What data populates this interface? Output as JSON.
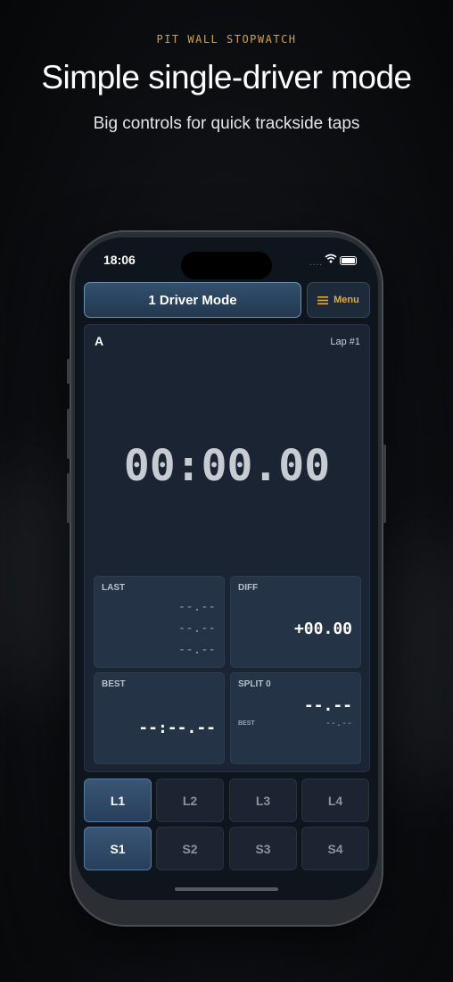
{
  "header": {
    "eyebrow": "PIT WALL STOPWATCH",
    "headline": "Simple single-driver mode",
    "subline": "Big controls for quick trackside taps"
  },
  "status_bar": {
    "time": "18:06",
    "signal": "....",
    "wifi_icon": "wifi-icon",
    "battery_icon": "battery-icon"
  },
  "app": {
    "mode_button": "1 Driver Mode",
    "menu_button": {
      "label": "Menu",
      "icon": "hamburger-icon"
    },
    "driver": "A",
    "lap": "Lap #1",
    "timer": "00:00.00",
    "cards": {
      "last": {
        "label": "LAST",
        "values": [
          "--.--",
          "--.--",
          "--.--"
        ]
      },
      "diff": {
        "label": "DIFF",
        "value": "+00.00"
      },
      "best": {
        "label": "BEST",
        "value": "--:--.--"
      },
      "split": {
        "label": "SPLIT 0",
        "value": "--.--",
        "best_label": "BEST",
        "best_value": "--.--"
      }
    },
    "lap_buttons": [
      "L1",
      "L2",
      "L3",
      "L4"
    ],
    "split_buttons": [
      "S1",
      "S2",
      "S3",
      "S4"
    ]
  },
  "colors": {
    "accent": "#d8a23a",
    "primary_button": "#34506e",
    "background": "#0f151d"
  }
}
